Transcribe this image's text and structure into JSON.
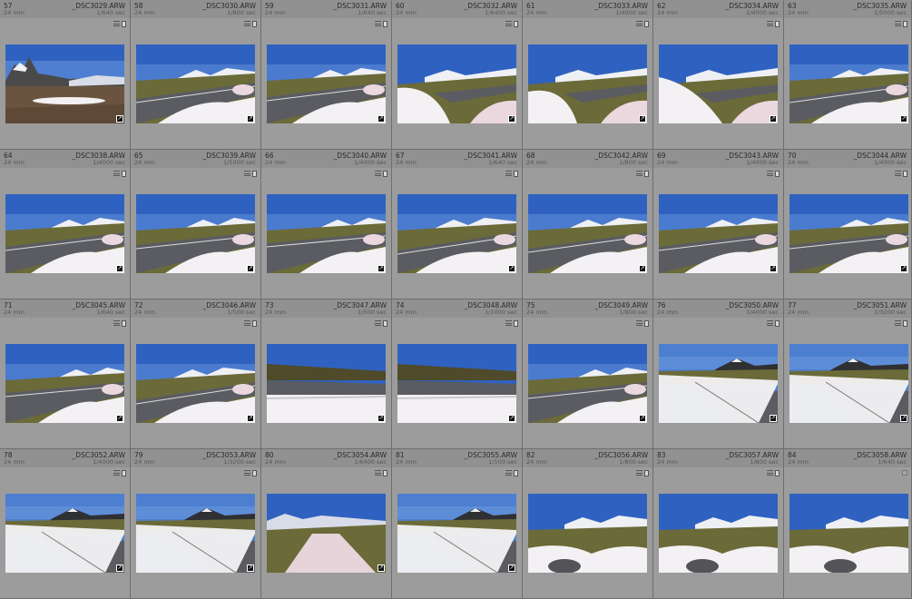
{
  "grid": {
    "cells": [
      {
        "index": "57",
        "filename": "_DSC3029.ARW",
        "focal": "24 mm",
        "shutter": "1/640 sec",
        "badges": [
          "metadata-icon",
          "document-icon"
        ],
        "scene": "landscape",
        "edited": true
      },
      {
        "index": "58",
        "filename": "_DSC3030.ARW",
        "focal": "24 mm",
        "shutter": "1/800 sec",
        "badges": [
          "metadata-icon",
          "document-icon"
        ],
        "scene": "road",
        "edited": true
      },
      {
        "index": "59",
        "filename": "_DSC3031.ARW",
        "focal": "24 mm",
        "shutter": "1/640 sec",
        "badges": [
          "metadata-icon",
          "document-icon"
        ],
        "scene": "road",
        "edited": true
      },
      {
        "index": "60",
        "filename": "_DSC3032.ARW",
        "focal": "24 mm",
        "shutter": "1/6400 sec",
        "badges": [
          "metadata-icon",
          "document-icon"
        ],
        "scene": "snowfg",
        "edited": true
      },
      {
        "index": "61",
        "filename": "_DSC3033.ARW",
        "focal": "24 mm",
        "shutter": "1/4000 sec",
        "badges": [
          "metadata-icon",
          "document-icon"
        ],
        "scene": "snowfg",
        "edited": true
      },
      {
        "index": "62",
        "filename": "_DSC3034.ARW",
        "focal": "24 mm",
        "shutter": "1/4000 sec",
        "badges": [
          "metadata-icon",
          "document-icon"
        ],
        "scene": "snowfg",
        "edited": true
      },
      {
        "index": "63",
        "filename": "_DSC3035.ARW",
        "focal": "24 mm",
        "shutter": "1/5000 sec",
        "badges": [
          "metadata-icon",
          "document-icon"
        ],
        "scene": "road",
        "edited": true
      },
      {
        "index": "64",
        "filename": "_DSC3038.ARW",
        "focal": "24 mm",
        "shutter": "1/4000 sec",
        "badges": [
          "metadata-icon",
          "document-icon"
        ],
        "scene": "road",
        "edited": true
      },
      {
        "index": "65",
        "filename": "_DSC3039.ARW",
        "focal": "24 mm",
        "shutter": "1/5000 sec",
        "badges": [
          "metadata-icon",
          "document-icon"
        ],
        "scene": "road",
        "edited": true
      },
      {
        "index": "66",
        "filename": "_DSC3040.ARW",
        "focal": "24 mm",
        "shutter": "1/4000 sec",
        "badges": [
          "metadata-icon",
          "document-icon"
        ],
        "scene": "road",
        "edited": true
      },
      {
        "index": "67",
        "filename": "_DSC3041.ARW",
        "focal": "24 mm",
        "shutter": "1/640 sec",
        "badges": [
          "metadata-icon",
          "document-icon"
        ],
        "scene": "road",
        "edited": true
      },
      {
        "index": "68",
        "filename": "_DSC3042.ARW",
        "focal": "24 mm",
        "shutter": "1/800 sec",
        "badges": [
          "metadata-icon",
          "document-icon"
        ],
        "scene": "road",
        "edited": true
      },
      {
        "index": "69",
        "filename": "_DSC3043.ARW",
        "focal": "24 mm",
        "shutter": "1/4000 sec",
        "badges": [
          "metadata-icon",
          "document-icon"
        ],
        "scene": "road",
        "edited": true
      },
      {
        "index": "70",
        "filename": "_DSC3044.ARW",
        "focal": "24 mm",
        "shutter": "1/4000 sec",
        "badges": [
          "metadata-icon",
          "document-icon"
        ],
        "scene": "road",
        "edited": true
      },
      {
        "index": "71",
        "filename": "_DSC3045.ARW",
        "focal": "24 mm",
        "shutter": "1/640 sec",
        "badges": [
          "metadata-icon",
          "document-icon"
        ],
        "scene": "road",
        "edited": true
      },
      {
        "index": "72",
        "filename": "_DSC3046.ARW",
        "focal": "24 mm",
        "shutter": "1/500 sec",
        "badges": [
          "metadata-icon",
          "document-icon"
        ],
        "scene": "road",
        "edited": true
      },
      {
        "index": "73",
        "filename": "_DSC3047.ARW",
        "focal": "24 mm",
        "shutter": "1/500 sec",
        "badges": [
          "metadata-icon",
          "document-icon"
        ],
        "scene": "low",
        "edited": true
      },
      {
        "index": "74",
        "filename": "_DSC3048.ARW",
        "focal": "24 mm",
        "shutter": "1/1000 sec",
        "badges": [
          "metadata-icon",
          "document-icon"
        ],
        "scene": "low",
        "edited": true
      },
      {
        "index": "75",
        "filename": "_DSC3049.ARW",
        "focal": "24 mm",
        "shutter": "1/800 sec",
        "badges": [
          "metadata-icon",
          "document-icon"
        ],
        "scene": "road",
        "edited": true
      },
      {
        "index": "76",
        "filename": "_DSC3050.ARW",
        "focal": "24 mm",
        "shutter": "1/4000 sec",
        "badges": [
          "metadata-icon",
          "document-icon"
        ],
        "scene": "pale",
        "edited": true
      },
      {
        "index": "77",
        "filename": "_DSC3051.ARW",
        "focal": "24 mm",
        "shutter": "1/3200 sec",
        "badges": [
          "metadata-icon",
          "document-icon"
        ],
        "scene": "pale",
        "edited": true
      },
      {
        "index": "78",
        "filename": "_DSC3052.ARW",
        "focal": "24 mm",
        "shutter": "1/4000 sec",
        "badges": [
          "metadata-icon",
          "document-icon"
        ],
        "scene": "pale",
        "edited": true
      },
      {
        "index": "79",
        "filename": "_DSC3053.ARW",
        "focal": "24 mm",
        "shutter": "1/3200 sec",
        "badges": [
          "metadata-icon",
          "document-icon"
        ],
        "scene": "pale",
        "edited": true
      },
      {
        "index": "80",
        "filename": "_DSC3054.ARW",
        "focal": "24 mm",
        "shutter": "1/6400 sec",
        "badges": [
          "metadata-icon",
          "document-icon"
        ],
        "scene": "snowpath",
        "edited": true
      },
      {
        "index": "81",
        "filename": "_DSC3055.ARW",
        "focal": "24 mm",
        "shutter": "1/500 sec",
        "badges": [
          "metadata-icon",
          "document-icon"
        ],
        "scene": "pale",
        "edited": true
      },
      {
        "index": "82",
        "filename": "_DSC3056.ARW",
        "focal": "24 mm",
        "shutter": "1/800 sec",
        "badges": [
          "metadata-icon",
          "document-icon"
        ],
        "scene": "snowfield",
        "edited": false
      },
      {
        "index": "83",
        "filename": "_DSC3057.ARW",
        "focal": "24 mm",
        "shutter": "1/800 sec",
        "badges": [
          "metadata-icon",
          "document-icon"
        ],
        "scene": "snowfield",
        "edited": false
      },
      {
        "index": "84",
        "filename": "_DSC3058.ARW",
        "focal": "24 mm",
        "shutter": "1/640 sec",
        "badges": [
          "empty-badge-icon"
        ],
        "scene": "snowfield",
        "edited": false
      }
    ]
  },
  "colors": {
    "background": "#8a8a8a",
    "cell": "#9c9c9c",
    "cell_header": "#919191",
    "sky": "#2f62c0",
    "grass": "#6e6a3a",
    "road": "#5c5e63",
    "snow": "#f2f0f3"
  }
}
